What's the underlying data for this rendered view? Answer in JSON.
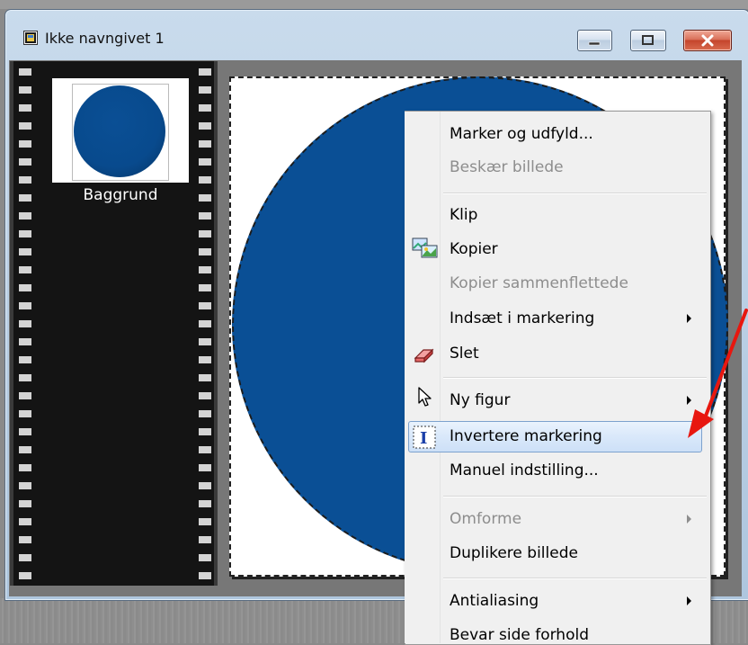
{
  "window": {
    "title": "Ikke navngivet 1",
    "icons": {
      "app": "image-document-icon",
      "minimize": "minimize-icon",
      "maximize": "maximize-icon",
      "close": "close-icon"
    }
  },
  "layers": [
    {
      "name": "Baggrund",
      "color": "#0a4f95"
    }
  ],
  "canvas": {
    "shape_color": "#0a4f95"
  },
  "context_menu": {
    "items": [
      {
        "label": "Marker og udfyld...",
        "enabled": true
      },
      {
        "label": "Beskær billede",
        "enabled": false
      },
      {
        "label": "Klip",
        "enabled": true
      },
      {
        "label": "Kopier",
        "enabled": true,
        "icon": "copy-picture-icon"
      },
      {
        "label": "Kopier sammenflettede",
        "enabled": false
      },
      {
        "label": "Indsæt i markering",
        "enabled": true,
        "submenu": true
      },
      {
        "label": "Slet",
        "enabled": true,
        "icon": "eraser-icon"
      },
      {
        "label": "Ny figur",
        "enabled": true,
        "submenu": true,
        "icon": "cursor-arrow-icon"
      },
      {
        "label": "Invertere markering",
        "enabled": true,
        "highlighted": true,
        "icon": "invert-selection-icon"
      },
      {
        "label": "Manuel indstilling...",
        "enabled": true
      },
      {
        "label": "Omforme",
        "enabled": false,
        "submenu": true
      },
      {
        "label": "Duplikere billede",
        "enabled": true
      },
      {
        "label": "Antialiasing",
        "enabled": true,
        "submenu": true
      },
      {
        "label": "Bevar side forhold",
        "enabled": true
      }
    ],
    "highlight_color": "#cde0f7"
  },
  "annotation": {
    "arrow_color": "#e8170f"
  }
}
